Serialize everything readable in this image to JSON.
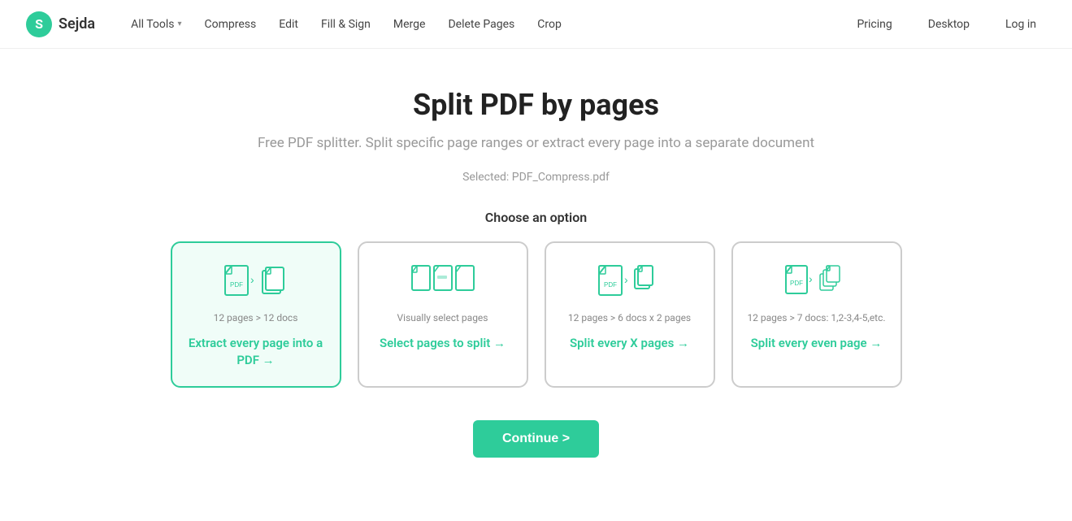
{
  "brand": {
    "logo_letter": "S",
    "logo_name": "Sejda"
  },
  "nav": {
    "left_items": [
      {
        "label": "All Tools",
        "has_arrow": true
      },
      {
        "label": "Compress",
        "has_arrow": false
      },
      {
        "label": "Edit",
        "has_arrow": false
      },
      {
        "label": "Fill & Sign",
        "has_arrow": false
      },
      {
        "label": "Merge",
        "has_arrow": false
      },
      {
        "label": "Delete Pages",
        "has_arrow": false
      },
      {
        "label": "Crop",
        "has_arrow": false
      }
    ],
    "right_items": [
      {
        "label": "Pricing"
      },
      {
        "label": "Desktop"
      },
      {
        "label": "Log in"
      }
    ]
  },
  "hero": {
    "title": "Split PDF by pages",
    "subtitle": "Free PDF splitter. Split specific page ranges or extract every page into a separate document",
    "selected_file_prefix": "Selected:",
    "selected_file_name": "PDF_Compress.pdf"
  },
  "options": {
    "section_label": "Choose an option",
    "cards": [
      {
        "pages_desc": "12 pages > 12 docs",
        "label": "Extract every page into a PDF →",
        "selected": true
      },
      {
        "pages_desc": "Visually select pages",
        "label": "Select pages to split →",
        "selected": false
      },
      {
        "pages_desc": "12 pages > 6 docs x 2 pages",
        "label": "Split every X pages →",
        "selected": false
      },
      {
        "pages_desc": "12 pages > 7 docs: 1,2-3,4-5,etc.",
        "label": "Split every even page →",
        "selected": false
      }
    ]
  },
  "continue_button": {
    "label": "Continue >"
  }
}
